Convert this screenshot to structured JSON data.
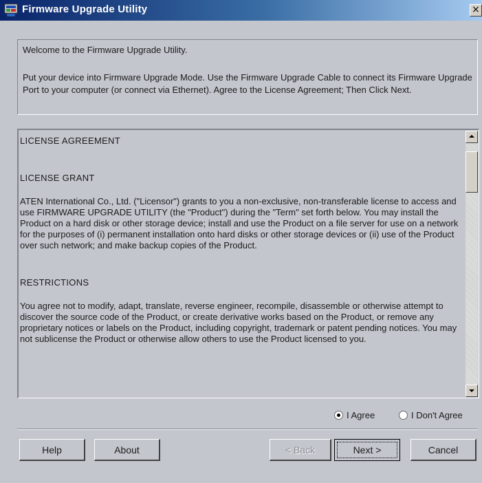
{
  "window": {
    "title": "Firmware Upgrade Utility",
    "close_glyph": "×",
    "app_icon": "app-window-icon"
  },
  "welcome": {
    "line1": "Welcome to the Firmware Upgrade Utility.",
    "line2": "Put your device into Firmware Upgrade Mode. Use the Firmware Upgrade Cable to connect its Firmware Upgrade Port to your computer (or connect via Ethernet). Agree to the License Agreement; Then Click Next."
  },
  "license": {
    "heading1": "LICENSE AGREEMENT",
    "heading2": "LICENSE GRANT",
    "grant_text": "ATEN International Co., Ltd. (\"Licensor\") grants to you a non-exclusive, non-transferable license to access and use FIRMWARE UPGRADE UTILITY (the \"Product\") during the \"Term\" set forth below. You may install the Product on a hard disk or other storage device; install and use the Product on a file server for use on a network for the purposes of (i) permanent installation onto hard disks or other storage devices or (ii) use of the Product over such network; and make backup copies of the Product.",
    "heading3": "RESTRICTIONS",
    "restrictions_text": "You agree not to modify, adapt, translate, reverse engineer, recompile, disassemble or otherwise attempt to discover the source code of the Product, or create derivative works based on the Product, or remove any proprietary notices or labels on the Product, including copyright, trademark or patent pending notices. You may not sublicense the Product or otherwise allow others to use the Product licensed to you."
  },
  "agreement": {
    "agree_label": "I Agree",
    "disagree_label": "I Don't Agree",
    "selected": "agree"
  },
  "buttons": {
    "help": "Help",
    "about": "About",
    "back": "< Back",
    "next": "Next >",
    "cancel": "Cancel"
  },
  "colors": {
    "title_bar_start": "#0a246a",
    "title_bar_end": "#a6caf0",
    "window_bg": "#c3c6cd"
  }
}
